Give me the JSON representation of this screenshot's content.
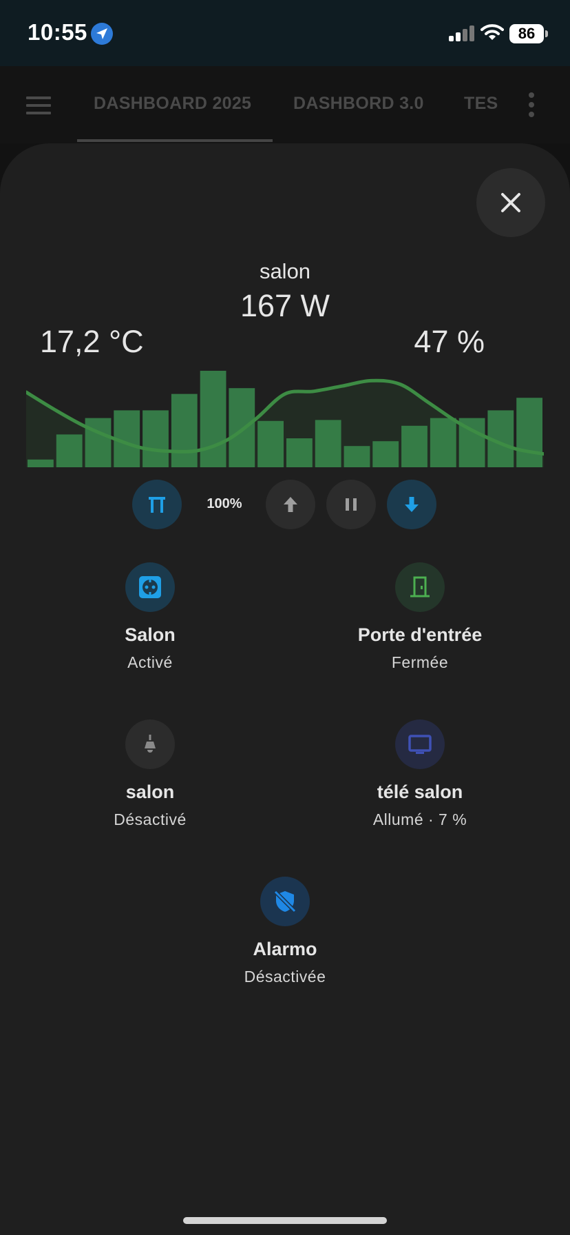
{
  "status_bar": {
    "time": "10:55",
    "battery": "86",
    "icons": [
      "location-arrow-icon",
      "cellular-signal-icon",
      "wifi-icon",
      "battery-icon"
    ]
  },
  "header": {
    "tabs": [
      {
        "label": "DASHBOARD 2025",
        "active": true
      },
      {
        "label": "DASHBORD 3.0",
        "active": false
      },
      {
        "label": "TES",
        "active": false
      }
    ]
  },
  "room": {
    "name": "salon",
    "power": "167 W",
    "temperature": "17,2 °C",
    "humidity": "47 %"
  },
  "chart_data": {
    "type": "bar",
    "title": "",
    "bar_series": {
      "name": "",
      "color": "#3a8b4f",
      "values": [
        0.08,
        0.34,
        0.51,
        0.59,
        0.59,
        0.76,
        1.0,
        0.82,
        0.48,
        0.3,
        0.49,
        0.22,
        0.27,
        0.43,
        0.51,
        0.51,
        0.59,
        0.72
      ]
    },
    "line_series": {
      "name": "",
      "color": "#3d8c44",
      "values": [
        0.82,
        0.62,
        0.44,
        0.3,
        0.19,
        0.15,
        0.16,
        0.28,
        0.52,
        0.8,
        0.83,
        0.89,
        0.95,
        0.91,
        0.7,
        0.48,
        0.31,
        0.18,
        0.12
      ],
      "ylim": [
        0,
        1
      ]
    },
    "xlabel": "",
    "ylabel": "",
    "grid": false,
    "legend": "none"
  },
  "cover": {
    "position": "100%",
    "buttons": [
      "gate-icon",
      "arrow-up-icon",
      "pause-icon",
      "arrow-down-icon"
    ]
  },
  "entities": [
    {
      "name": "Salon",
      "state": "Activé",
      "icon": "power-socket-icon",
      "color": "#1f9fe6"
    },
    {
      "name": "Porte d'entrée",
      "state": "Fermée",
      "icon": "door-closed-icon",
      "color": "#4caf50"
    },
    {
      "name": "salon",
      "state": "Désactivé",
      "icon": "ceiling-light-icon",
      "color": "#8a8a8a"
    },
    {
      "name": "télé salon",
      "state": "Allumé · 7 %",
      "icon": "television-icon",
      "color": "#3f51b5"
    },
    {
      "name": "Alarmo",
      "state": "Désactivée",
      "icon": "shield-off-icon",
      "color": "#1f88e5"
    }
  ],
  "colors": {
    "status_bar": "#0f1c22",
    "dialog_bg": "#1f1f1f",
    "accent_blue": "#1f9fe6",
    "green": "#4caf50"
  }
}
